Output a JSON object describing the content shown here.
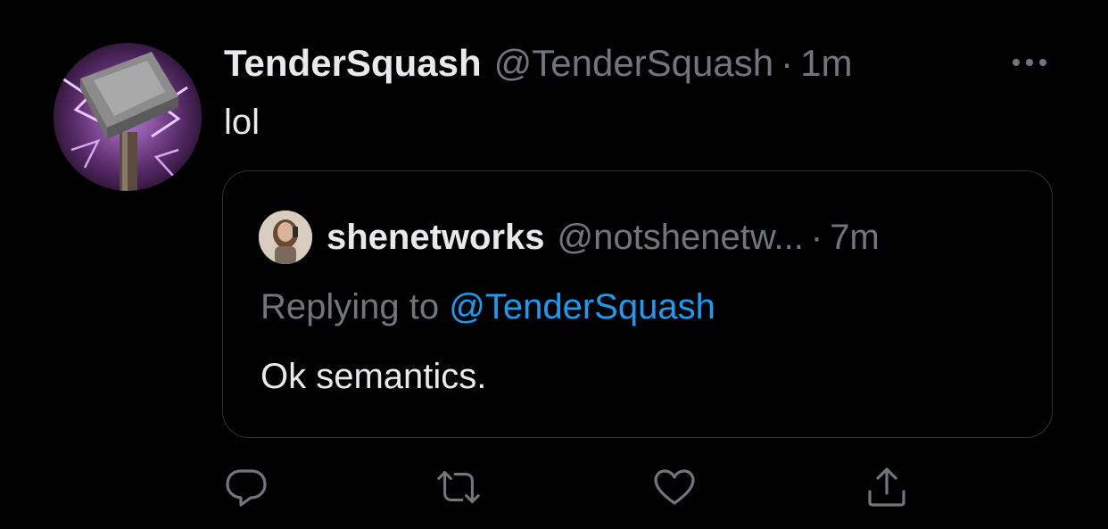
{
  "tweet": {
    "display_name": "TenderSquash",
    "handle": "@TenderSquash",
    "separator": "·",
    "time": "1m",
    "text": "lol",
    "avatar_icon": "hammer-avatar-icon",
    "more_icon": "more-options-icon"
  },
  "quote": {
    "display_name": "shenetworks",
    "handle": "@notshenetw...",
    "separator": "·",
    "time": "7m",
    "replying_label": "Replying to",
    "replying_handle": "@TenderSquash",
    "text": "Ok semantics."
  },
  "actions": [
    {
      "icon": "reply-icon"
    },
    {
      "icon": "retweet-icon"
    },
    {
      "icon": "like-icon"
    },
    {
      "icon": "share-icon"
    }
  ],
  "colors": {
    "background": "#000000",
    "primary_text": "#e7e9ea",
    "secondary_text": "#71767b",
    "link": "#1d9bf0",
    "border": "#2f3336"
  }
}
